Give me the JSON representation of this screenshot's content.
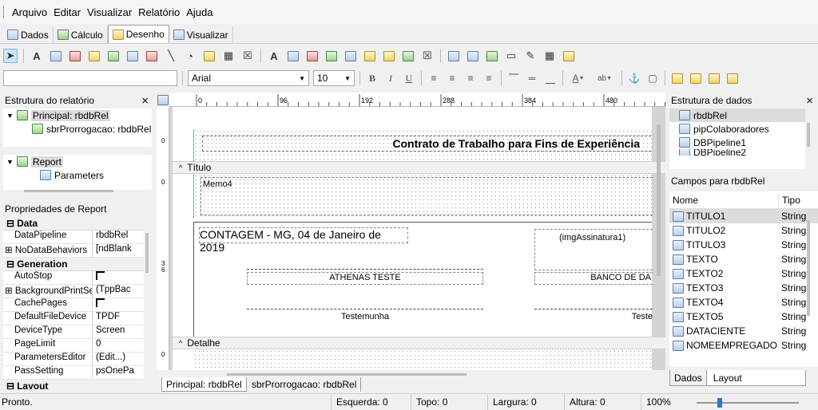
{
  "menu": [
    "Arquivo",
    "Editar",
    "Visualizar",
    "Relatório",
    "Ajuda"
  ],
  "view_tabs": [
    {
      "label": "Dados",
      "icon": "data-pipeline-icon"
    },
    {
      "label": "Cálculo",
      "icon": "calculator-icon"
    },
    {
      "label": "Desenho",
      "icon": "design-icon",
      "active": true
    },
    {
      "label": "Visualizar",
      "icon": "preview-icon"
    }
  ],
  "format_bar": {
    "component_value": "",
    "font_name": "Arial",
    "font_size": "10",
    "bold": "B",
    "italic": "I",
    "underline": "U"
  },
  "report_tree": {
    "title": "Estrutura do relatório",
    "close": "×",
    "items": [
      {
        "label": "Principal: rbdbRel",
        "level": 0
      },
      {
        "label": "sbrProrrogacao: rbdbRel",
        "level": 1
      }
    ],
    "items2": [
      {
        "label": "Report",
        "level": 0
      },
      {
        "label": "Parameters",
        "level": 1
      }
    ]
  },
  "properties": {
    "title": "Propriedades de Report",
    "groups": [
      {
        "name": "Data",
        "rows": [
          {
            "name": "DataPipeline",
            "value": "rbdbRel"
          },
          {
            "name": "NoDataBehaviors",
            "value": "[ndBlank",
            "expander": true
          }
        ]
      },
      {
        "name": "Generation",
        "rows": [
          {
            "name": "AutoStop",
            "value": "",
            "check": true
          },
          {
            "name": "BackgroundPrintSe",
            "value": "(TppBac",
            "expander": true
          },
          {
            "name": "CachePages",
            "value": "",
            "check": true
          },
          {
            "name": "DefaultFileDevice",
            "value": "TPDF"
          },
          {
            "name": "DeviceType",
            "value": "Screen"
          },
          {
            "name": "PageLimit",
            "value": "0"
          },
          {
            "name": "ParametersEditor",
            "value": "(Edit...)"
          },
          {
            "name": "PassSetting",
            "value": "psOnePa"
          }
        ]
      },
      {
        "name": "Layout",
        "rows": []
      }
    ]
  },
  "ruler": {
    "ticks": [
      "0",
      "96",
      "192",
      "288",
      "384",
      "480"
    ]
  },
  "designer": {
    "title_band": "Título",
    "detail_band": "Detalhe",
    "header_label": "Contrato de Trabalho para Fins de Experiência",
    "memo": "Memo4",
    "date_line": "CONTAGEM - MG, 04 de Janeiro de 2019",
    "image_label": "(imgAssinatura1)",
    "company_left": "ATHENAS TESTE",
    "company_right": "BANCO DE DA",
    "witness_left": "Testemunha",
    "witness_right": "Teste",
    "vruler_marks": [
      "0",
      "0",
      "3",
      "6",
      "0"
    ],
    "bottom_tabs": [
      "Principal: rbdbRel",
      "sbrProrrogacao: rbdbRel"
    ]
  },
  "data_tree": {
    "title": "Estrutura de dados",
    "close": "×",
    "items": [
      "rbdbRel",
      "pipColaboradores",
      "DBPipeline1",
      "DBPipeline2"
    ]
  },
  "fields": {
    "title": "Campos para rbdbRel",
    "col_name": "Nome",
    "col_type": "Tipo",
    "rows": [
      {
        "name": "TITULO1",
        "type": "String"
      },
      {
        "name": "TITULO2",
        "type": "String"
      },
      {
        "name": "TITULO3",
        "type": "String"
      },
      {
        "name": "TEXTO",
        "type": "String"
      },
      {
        "name": "TEXTO2",
        "type": "String"
      },
      {
        "name": "TEXTO3",
        "type": "String"
      },
      {
        "name": "TEXTO4",
        "type": "String"
      },
      {
        "name": "TEXTO5",
        "type": "String"
      },
      {
        "name": "DATACIENTE",
        "type": "String"
      },
      {
        "name": "NOMEEMPREGADO",
        "type": "String"
      }
    ],
    "tabs": [
      "Dados",
      "Layout"
    ]
  },
  "status": {
    "text": "Pronto.",
    "left": "Esquerda: 0",
    "top": "Topo: 0",
    "width": "Largura: 0",
    "height": "Altura: 0",
    "zoom": "100%"
  }
}
